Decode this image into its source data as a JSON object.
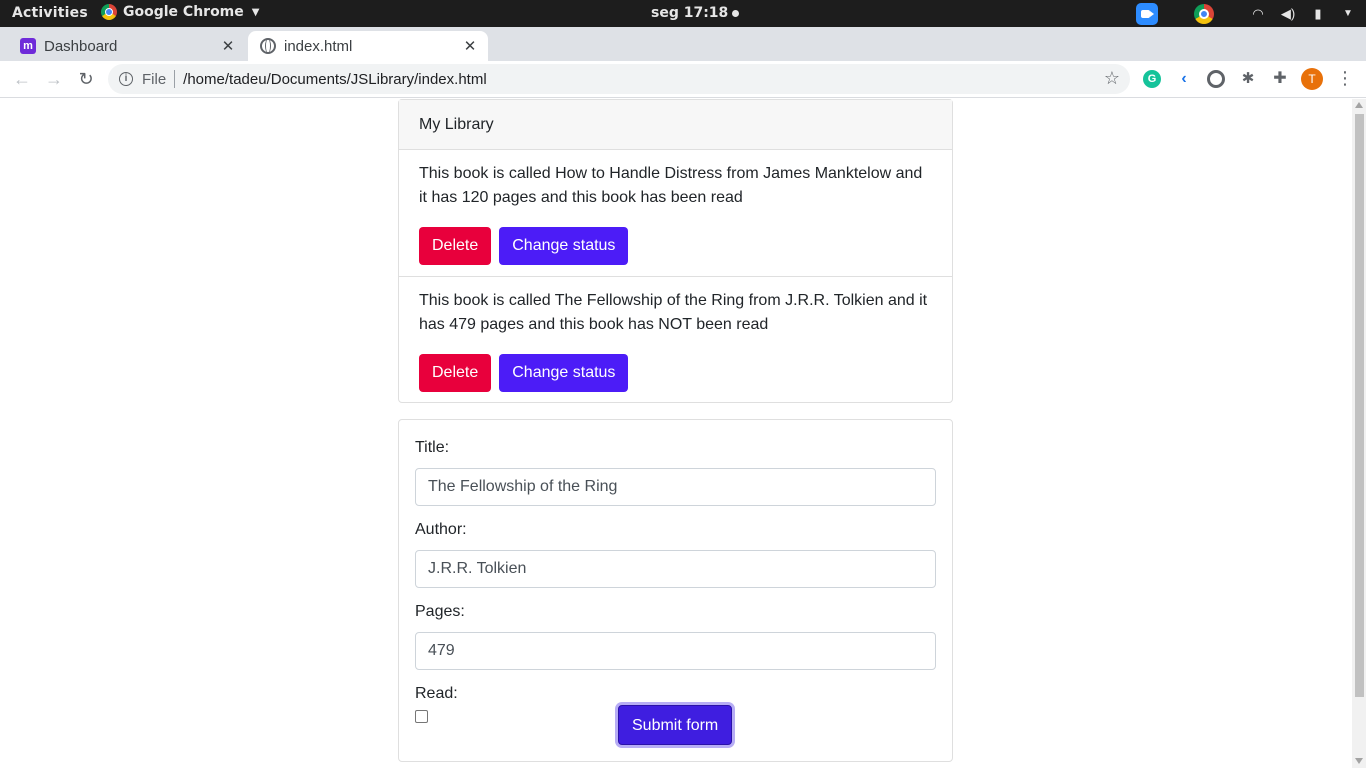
{
  "topbar": {
    "activities": "Activities",
    "app_name": "Google Chrome",
    "clock": "seg 17:18"
  },
  "tabs": [
    {
      "title": "Dashboard",
      "active": false
    },
    {
      "title": "index.html",
      "active": true
    }
  ],
  "omnibox": {
    "scheme_label": "File",
    "url": "/home/tadeu/Documents/JSLibrary/index.html"
  },
  "profile": {
    "initial": "T"
  },
  "library": {
    "header": "My Library",
    "books": [
      {
        "text": "This book is called How to Handle Distress from James Manktelow and it has 120 pages and this book has been read",
        "delete_label": "Delete",
        "status_label": "Change status"
      },
      {
        "text": "This book is called The Fellowship of the Ring from J.R.R. Tolkien and it has 479 pages and this book has NOT been read",
        "delete_label": "Delete",
        "status_label": "Change status"
      }
    ]
  },
  "form": {
    "title_label": "Title:",
    "title_value": "The Fellowship of the Ring",
    "author_label": "Author:",
    "author_value": "J.R.R. Tolkien",
    "pages_label": "Pages:",
    "pages_value": "479",
    "read_label": "Read:",
    "read_checked": false,
    "submit_label": "Submit form"
  },
  "colors": {
    "delete": "#e8003c",
    "change_status": "#4c1cf7",
    "submit": "#3f1ee0"
  }
}
